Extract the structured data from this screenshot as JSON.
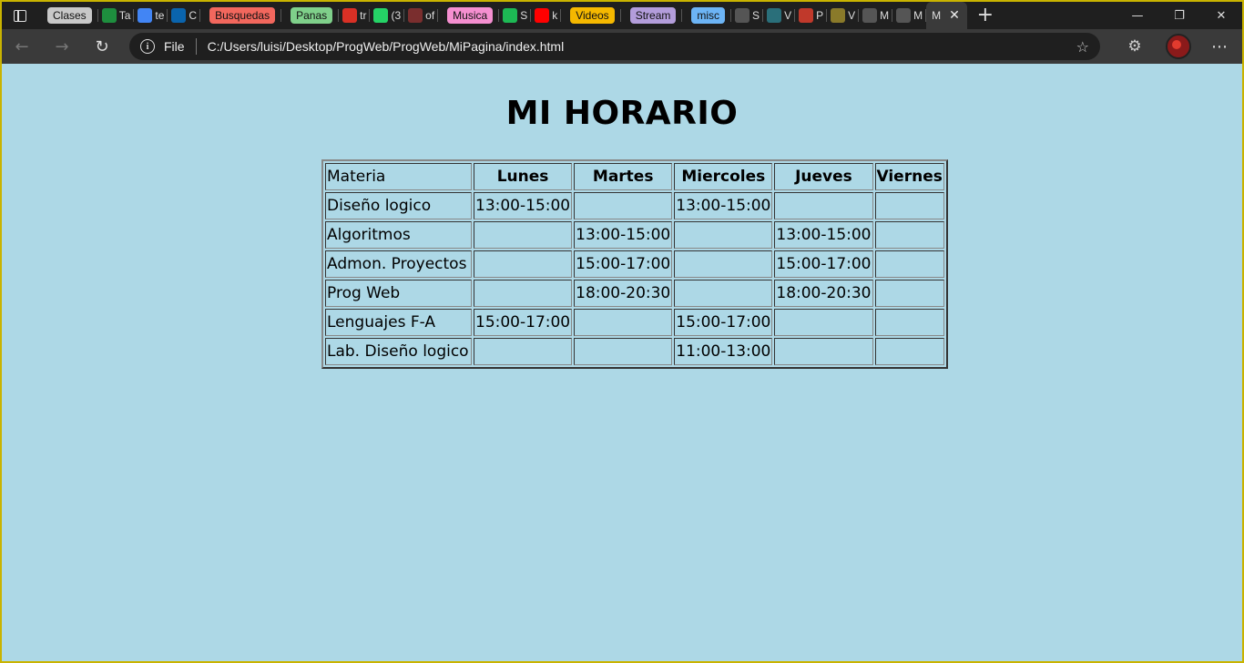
{
  "browser": {
    "tabs": [
      {
        "kind": "pill",
        "label": "Clases",
        "color": "#c8c8c8"
      },
      {
        "kind": "site",
        "icon": "classroom-icon",
        "icon_color": "#1e8e3e",
        "label": "Ta"
      },
      {
        "kind": "site",
        "icon": "drive-icon",
        "icon_color": "#4285f4",
        "label": "te"
      },
      {
        "kind": "site",
        "icon": "outlook-icon",
        "icon_color": "#0a64ad",
        "label": "C"
      },
      {
        "kind": "pill",
        "label": "Busquedas",
        "color": "#f2675d"
      },
      {
        "kind": "pill",
        "label": "Panas",
        "color": "#7fd08a"
      },
      {
        "kind": "site",
        "icon": "record-icon",
        "icon_color": "#d93025",
        "label": "tr"
      },
      {
        "kind": "site",
        "icon": "whatsapp-icon",
        "icon_color": "#25d366",
        "label": "(3"
      },
      {
        "kind": "site",
        "icon": "pdf-icon",
        "icon_color": "#7a2e2e",
        "label": "of"
      },
      {
        "kind": "pill",
        "label": "Musica",
        "color": "#f58fd0"
      },
      {
        "kind": "site",
        "icon": "spotify-icon",
        "icon_color": "#1db954",
        "label": "S"
      },
      {
        "kind": "site",
        "icon": "youtube-icon",
        "icon_color": "#ff0000",
        "label": "k"
      },
      {
        "kind": "pill",
        "label": "Videos",
        "color": "#f5b800"
      },
      {
        "kind": "pill",
        "label": "Stream",
        "color": "#b39ddb"
      },
      {
        "kind": "pill",
        "label": "misc",
        "color": "#6cb4f5"
      },
      {
        "kind": "site",
        "icon": "page-icon",
        "icon_color": "#555555",
        "label": "S"
      },
      {
        "kind": "site",
        "icon": "game-icon",
        "icon_color": "#2a6f7a",
        "label": "V"
      },
      {
        "kind": "site",
        "icon": "stack-icon",
        "icon_color": "#c0392b",
        "label": "P"
      },
      {
        "kind": "site",
        "icon": "texture-icon",
        "icon_color": "#8a7a2a",
        "label": "V"
      },
      {
        "kind": "site",
        "icon": "page-icon",
        "icon_color": "#555555",
        "label": "M"
      },
      {
        "kind": "site",
        "icon": "page-icon",
        "icon_color": "#555555",
        "label": "M"
      },
      {
        "kind": "active",
        "label": "M"
      }
    ],
    "address": {
      "scheme_label": "File",
      "url": "C:/Users/luisi/Desktop/ProgWeb/ProgWeb/MiPagina/index.html"
    }
  },
  "page": {
    "title": "MI HORARIO",
    "table": {
      "headers": [
        "Materia",
        "Lunes",
        "Martes",
        "Miercoles",
        "Jueves",
        "Viernes"
      ],
      "rows": [
        [
          "Diseño logico",
          "13:00-15:00",
          "",
          "13:00-15:00",
          "",
          ""
        ],
        [
          "Algoritmos",
          "",
          "13:00-15:00",
          "",
          "13:00-15:00",
          ""
        ],
        [
          "Admon. Proyectos",
          "",
          "15:00-17:00",
          "",
          "15:00-17:00",
          ""
        ],
        [
          "Prog Web",
          "",
          "18:00-20:30",
          "",
          "18:00-20:30",
          ""
        ],
        [
          "Lenguajes F-A",
          "15:00-17:00",
          "",
          "15:00-17:00",
          "",
          ""
        ],
        [
          "Lab. Diseño logico",
          "",
          "",
          "11:00-13:00",
          "",
          ""
        ]
      ]
    },
    "background_color": "#add8e6"
  }
}
